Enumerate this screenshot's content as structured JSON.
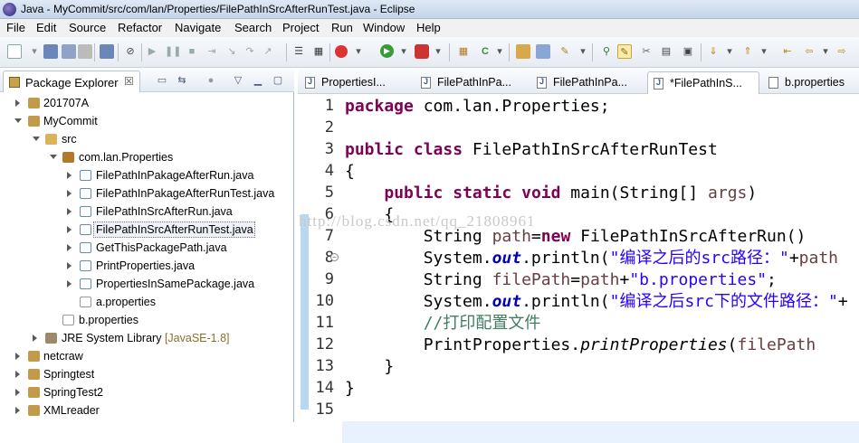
{
  "window": {
    "title": "Java - MyCommit/src/com/lan/Properties/FilePathInSrcAfterRunTest.java - Eclipse"
  },
  "menu": [
    "File",
    "Edit",
    "Source",
    "Refactor",
    "Navigate",
    "Search",
    "Project",
    "Run",
    "Window",
    "Help"
  ],
  "package_explorer": {
    "title": "Package Explorer",
    "close": "☒",
    "tree": [
      {
        "label": "201707A"
      },
      {
        "label": "MyCommit"
      },
      {
        "label": "src"
      },
      {
        "label": "com.lan.Properties"
      },
      {
        "label": "FilePathInPakageAfterRun.java"
      },
      {
        "label": "FilePathInPakageAfterRunTest.java"
      },
      {
        "label": "FilePathInSrcAfterRun.java"
      },
      {
        "label": "FilePathInSrcAfterRunTest.java"
      },
      {
        "label": "GetThisPackagePath.java"
      },
      {
        "label": "PrintProperties.java"
      },
      {
        "label": "PropertiesInSamePackage.java"
      },
      {
        "label": "a.properties"
      },
      {
        "label": "b.properties"
      },
      {
        "label": "JRE System Library",
        "suffix": "[JavaSE-1.8]"
      },
      {
        "label": "netcraw"
      },
      {
        "label": "Springtest"
      },
      {
        "label": "SpringTest2"
      },
      {
        "label": "XMLreader"
      }
    ]
  },
  "editor": {
    "tabs": [
      {
        "label": "PropertiesI..."
      },
      {
        "label": "FilePathInPa..."
      },
      {
        "label": "FilePathInPa..."
      },
      {
        "label": "*FilePathInS..."
      },
      {
        "label": "b.properties"
      }
    ],
    "line_numbers": [
      "1",
      "2",
      "3",
      "4",
      "5",
      "6",
      "7",
      "8",
      "9",
      "10",
      "11",
      "12",
      "13",
      "14",
      "15"
    ],
    "code": {
      "l1_kw": "package",
      "l1_rest": " com.lan.Properties;",
      "l3_kw1": "public",
      "l3_kw2": "class",
      "l3_rest": " FilePathInSrcAfterRunTest",
      "l4": "{",
      "l5_kw1": "public",
      "l5_kw2": "static",
      "l5_kw3": "void",
      "l5_rest": " main(String[] ",
      "l5_arg": "args",
      "l5_end": ")",
      "l6": "{",
      "l7_a": "String ",
      "l7_var": "path",
      "l7_b": "=",
      "l7_kw": "new",
      "l7_c": " FilePathInSrcAfterRun()",
      "l8_a": "System.",
      "l8_fld": "out",
      "l8_b": ".println(",
      "l8_str": "\"编译之后的src路径：\"",
      "l8_c": "+",
      "l8_var": "path",
      "l9_a": "String ",
      "l9_var": "filePath",
      "l9_b": "=",
      "l9_var2": "path",
      "l9_c": "+",
      "l9_str": "\"b.properties\"",
      "l9_d": ";",
      "l10_a": "System.",
      "l10_fld": "out",
      "l10_b": ".println(",
      "l10_str": "\"编译之后src下的文件路径：\"",
      "l10_c": "+",
      "l11_cm": "//打印配置文件",
      "l12_a": "PrintProperties.",
      "l12_it": "printProperties",
      "l12_b": "(",
      "l12_var": "filePath",
      "l13": "}",
      "l14": "}"
    },
    "watermark": "http://blog.csdn.net/qq_21808961"
  }
}
